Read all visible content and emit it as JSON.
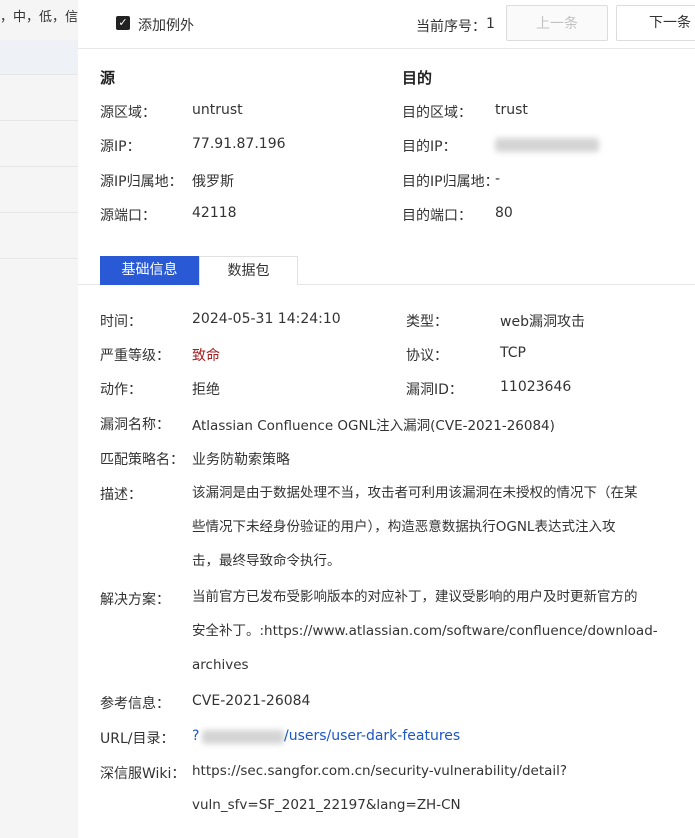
{
  "backdrop": {
    "text": "，中，低，信"
  },
  "topbar": {
    "add_exception_label": "添加例外",
    "checkbox_mark": "✓",
    "seq_label": "当前序号：",
    "seq_value": "1",
    "prev_label": "上一条",
    "next_label": "下一条"
  },
  "source": {
    "title": "源",
    "zone_label": "源区域：",
    "zone_value": "untrust",
    "ip_label": "源IP：",
    "ip_value": "77.91.87.196",
    "geo_label": "源IP归属地：",
    "geo_value": "俄罗斯",
    "port_label": "源端口：",
    "port_value": "42118"
  },
  "dest": {
    "title": "目的",
    "zone_label": "目的区域：",
    "zone_value": "trust",
    "ip_label": "目的IP：",
    "geo_label": "目的IP归属地：",
    "geo_value": "-",
    "port_label": "目的端口：",
    "port_value": "80"
  },
  "tabs": {
    "basic": "基础信息",
    "packet": "数据包"
  },
  "basic": {
    "time_label": "时间：",
    "time_value": "2024-05-31 14:24:10",
    "type_label": "类型：",
    "type_value": "web漏洞攻击",
    "severity_label": "严重等级：",
    "severity_value": "致命",
    "protocol_label": "协议：",
    "protocol_value": "TCP",
    "action_label": "动作：",
    "action_value": "拒绝",
    "vulnid_label": "漏洞ID：",
    "vulnid_value": "11023646",
    "vulnname_label": "漏洞名称：",
    "vulnname_value": "Atlassian Confluence OGNL注入漏洞(CVE-2021-26084)",
    "policy_label": "匹配策略名：",
    "policy_value": "业务防勒索策略",
    "desc_label": "描述：",
    "desc_lines": [
      "该漏洞是由于数据处理不当，攻击者可利用该漏洞在未授权的情况下（在某",
      "些情况下未经身份验证的用户），构造恶意数据执行OGNL表达式注入攻",
      "击，最终导致命令执行。"
    ],
    "solution_label": "解决方案：",
    "solution_lines": [
      "当前官方已发布受影响版本的对应补丁，建议受影响的用户及时更新官方的",
      "安全补丁。:https://www.atlassian.com/software/confluence/download-",
      "archives"
    ],
    "ref_label": "参考信息：",
    "ref_value": "CVE-2021-26084",
    "url_label": "URL/目录：",
    "url_prefix": "?",
    "url_value": "/users/user-dark-features",
    "wiki_label": "深信服Wiki：",
    "wiki_lines": [
      "https://sec.sangfor.com.cn/security-vulnerability/detail?",
      "vuln_sfv=SF_2021_22197&lang=ZH-CN"
    ]
  },
  "colors": {
    "accent": "#2a59d6",
    "severity": "#a42020",
    "link": "#1a56c4"
  }
}
